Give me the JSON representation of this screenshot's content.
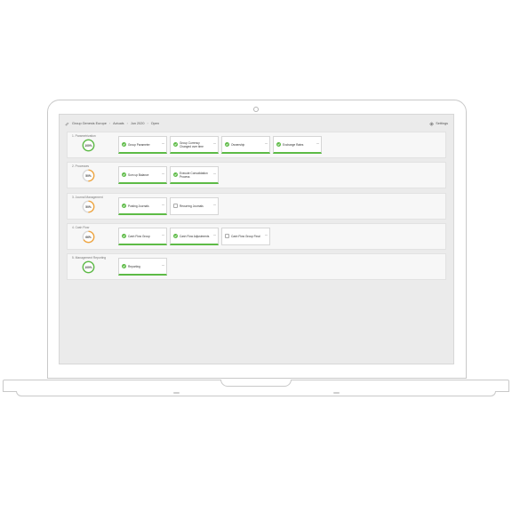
{
  "header": {
    "breadcrumb": [
      "Group Genesis Europe",
      "Actuals",
      "Jun 2020",
      "Open"
    ],
    "settings_label": "Settings"
  },
  "colors": {
    "done": "#5dbb46",
    "progress": "#f0a640",
    "track": "#d8d8d8"
  },
  "sections": [
    {
      "label": "1. Parametrization",
      "percent_text": "100%",
      "progress": 1.0,
      "tasks": [
        {
          "name": "Group Parameter",
          "status": "done"
        },
        {
          "name": "Group Currency Changed over time",
          "status": "done"
        },
        {
          "name": "Ownership",
          "status": "done"
        },
        {
          "name": "Exchange Rates",
          "status": "done"
        }
      ]
    },
    {
      "label": "2.  Processes",
      "percent_text": "50%",
      "progress": 0.5,
      "tasks": [
        {
          "name": "Sum up Balance",
          "status": "done"
        },
        {
          "name": "Execute Consolidation Process",
          "status": "done"
        }
      ]
    },
    {
      "label": "3. Journal Management",
      "percent_text": "50%",
      "progress": 0.5,
      "tasks": [
        {
          "name": "Posting Journals",
          "status": "done"
        },
        {
          "name": "Recurring Journals",
          "status": "open"
        }
      ]
    },
    {
      "label": "4. Cash Flow",
      "percent_text": "66%",
      "progress": 0.66,
      "tasks": [
        {
          "name": "Cash Flow Group",
          "status": "done"
        },
        {
          "name": "Cash Flow Adjustments",
          "status": "done"
        },
        {
          "name": "Cash Flow Group Final",
          "status": "open"
        }
      ]
    },
    {
      "label": "5. Management Reporting",
      "percent_text": "100%",
      "progress": 1.0,
      "tasks": [
        {
          "name": "Reporting",
          "status": "done"
        }
      ]
    }
  ],
  "more_glyph": "···"
}
